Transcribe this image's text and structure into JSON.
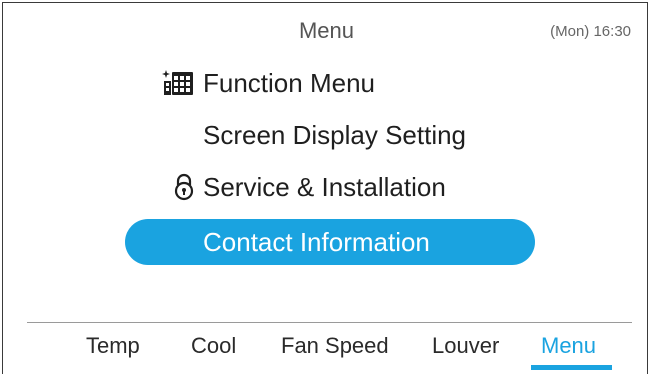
{
  "header": {
    "title": "Menu",
    "clock": "(Mon) 16:30"
  },
  "menu": {
    "items": [
      {
        "label": "Function Menu",
        "icon": "calendar-grid-icon",
        "selected": false
      },
      {
        "label": "Screen Display Setting",
        "icon": "",
        "selected": false
      },
      {
        "label": "Service & Installation",
        "icon": "padlock-icon",
        "selected": false
      },
      {
        "label": "Contact Information",
        "icon": "",
        "selected": true
      }
    ]
  },
  "tabs": {
    "items": [
      {
        "label": "Temp",
        "active": false
      },
      {
        "label": "Cool",
        "active": false
      },
      {
        "label": "Fan Speed",
        "active": false
      },
      {
        "label": "Louver",
        "active": false
      },
      {
        "label": "Menu",
        "active": true
      }
    ]
  },
  "colors": {
    "accent": "#1aa3e0",
    "text": "#1f1f1f",
    "muted": "#666666",
    "border": "#3a3a3a"
  }
}
